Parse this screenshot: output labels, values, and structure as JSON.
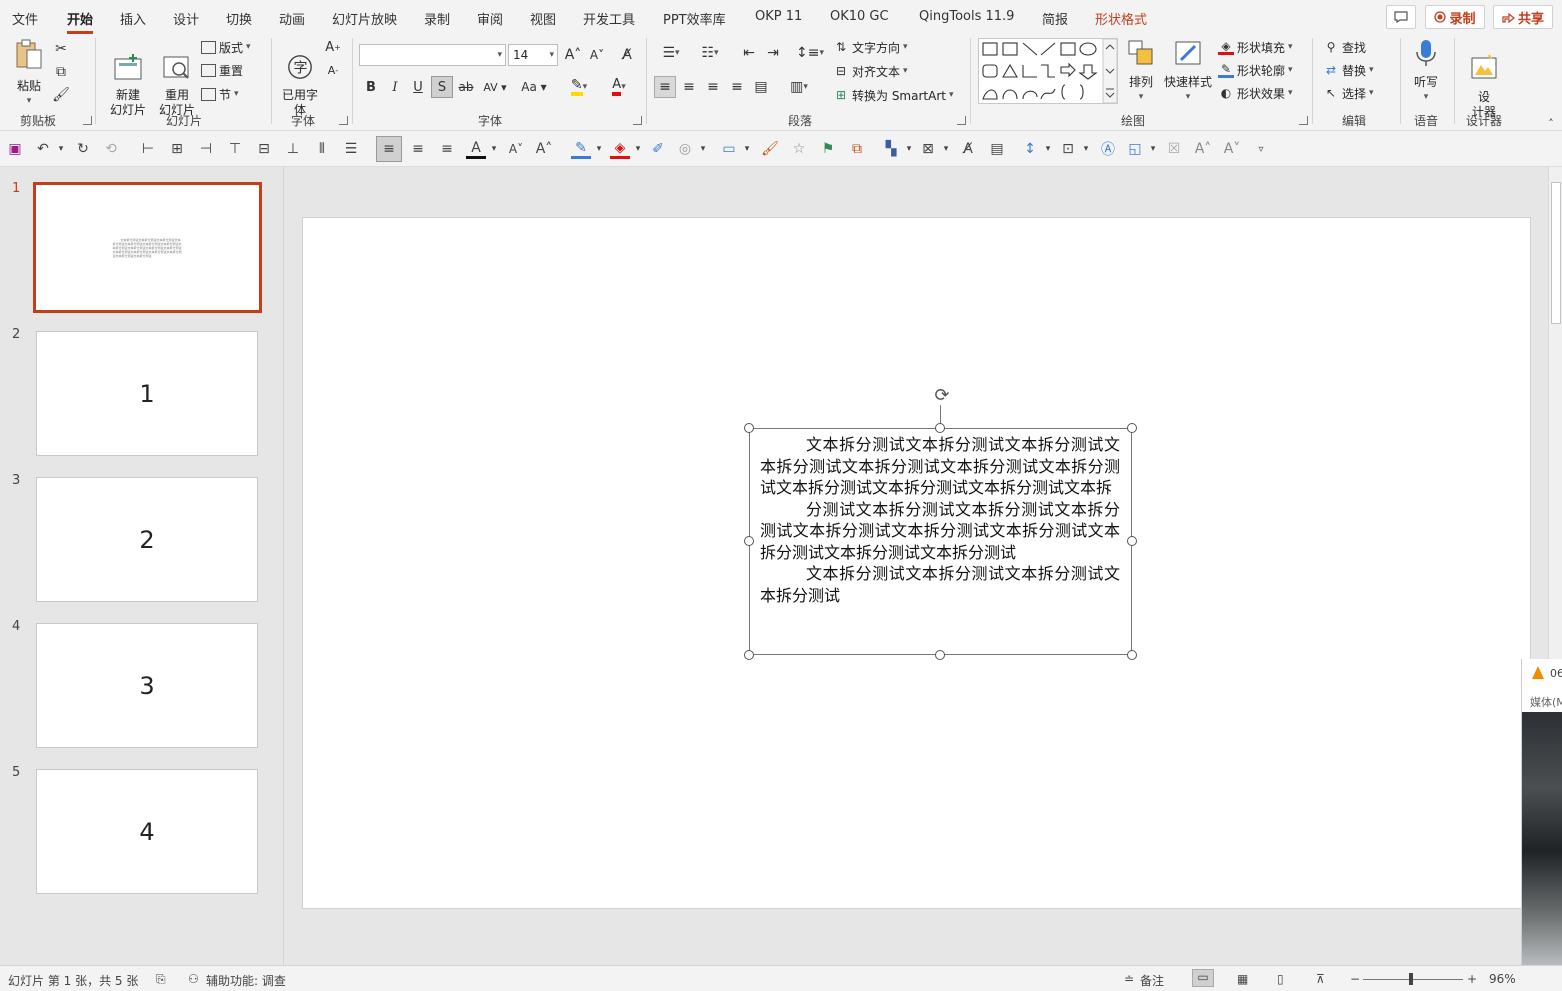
{
  "tabs": [
    "文件",
    "开始",
    "插入",
    "设计",
    "切换",
    "动画",
    "幻灯片放映",
    "录制",
    "审阅",
    "视图",
    "开发工具",
    "PPT效率库",
    "OKP 11",
    "OK10 GC",
    "QingTools 11.9",
    "简报",
    "形状格式"
  ],
  "top_buttons": {
    "comment_icon": "comment-icon",
    "record": "录制",
    "share": "共享"
  },
  "ribbon": {
    "clipboard": {
      "paste": "粘贴",
      "label": "剪贴板"
    },
    "slides": {
      "new_slide": "新建\n幻灯片",
      "reuse": "重用\n幻灯片",
      "layout": "版式",
      "reset": "重置",
      "section": "节",
      "label": "幻灯片"
    },
    "font_group_a": {
      "used_fonts": "已用字\n体",
      "label": "字体"
    },
    "font": {
      "font_name": "",
      "font_size": "14",
      "label": "字体"
    },
    "paragraph": {
      "text_direction": "文字方向",
      "align_text": "对齐文本",
      "smartart": "转换为 SmartArt",
      "label": "段落"
    },
    "drawing": {
      "arrange": "排列",
      "quick_styles": "快速样式",
      "shape_fill": "形状填充",
      "shape_outline": "形状轮廓",
      "shape_effects": "形状效果",
      "label": "绘图"
    },
    "editing": {
      "find": "查找",
      "replace": "替换",
      "select": "选择",
      "label": "编辑"
    },
    "voice": {
      "dictate": "听写",
      "label": "语音"
    },
    "designer": {
      "design_ideas": "设\n计器",
      "label": "设计器"
    }
  },
  "thumbnails": [
    {
      "num": "1",
      "text": "文本拆分测试文本拆分测试文本拆分测试文本拆分测试文本拆分测试文本拆分测试文本拆分测试文本拆分测试文本拆分测试文本拆分测试文本拆分测试文本拆分测试文本拆分测试文本拆分测试文本拆分测试文本拆分测试文本拆分测试"
    },
    {
      "num": "2",
      "text": "1"
    },
    {
      "num": "3",
      "text": "2"
    },
    {
      "num": "4",
      "text": "3"
    },
    {
      "num": "5",
      "text": "4"
    }
  ],
  "slide": {
    "paragraphs": [
      "文本拆分测试文本拆分测试文本拆分测试文本拆分测试文本拆分测试文本拆分测试文本拆分测试文本拆分测试文本拆分测试文本拆分测试文本拆",
      "分测试文本拆分测试文本拆分测试文本拆分测试文本拆分测试文本拆分测试文本拆分测试文本拆分测试文本拆分测试文本拆分测试",
      "文本拆分测试文本拆分测试文本拆分测试文本拆分测试"
    ]
  },
  "overlay": {
    "title": "06",
    "menu": "媒体(M"
  },
  "status": {
    "slide_info": "幻灯片 第 1 张，共 5 张",
    "accessibility": "辅助功能: 调查",
    "notes": "备注",
    "zoom": "96%"
  },
  "colors": {
    "accent": "#c43e1c",
    "ribbon_bg": "#f3f3f3",
    "canvas_bg": "#e6e6e6"
  }
}
